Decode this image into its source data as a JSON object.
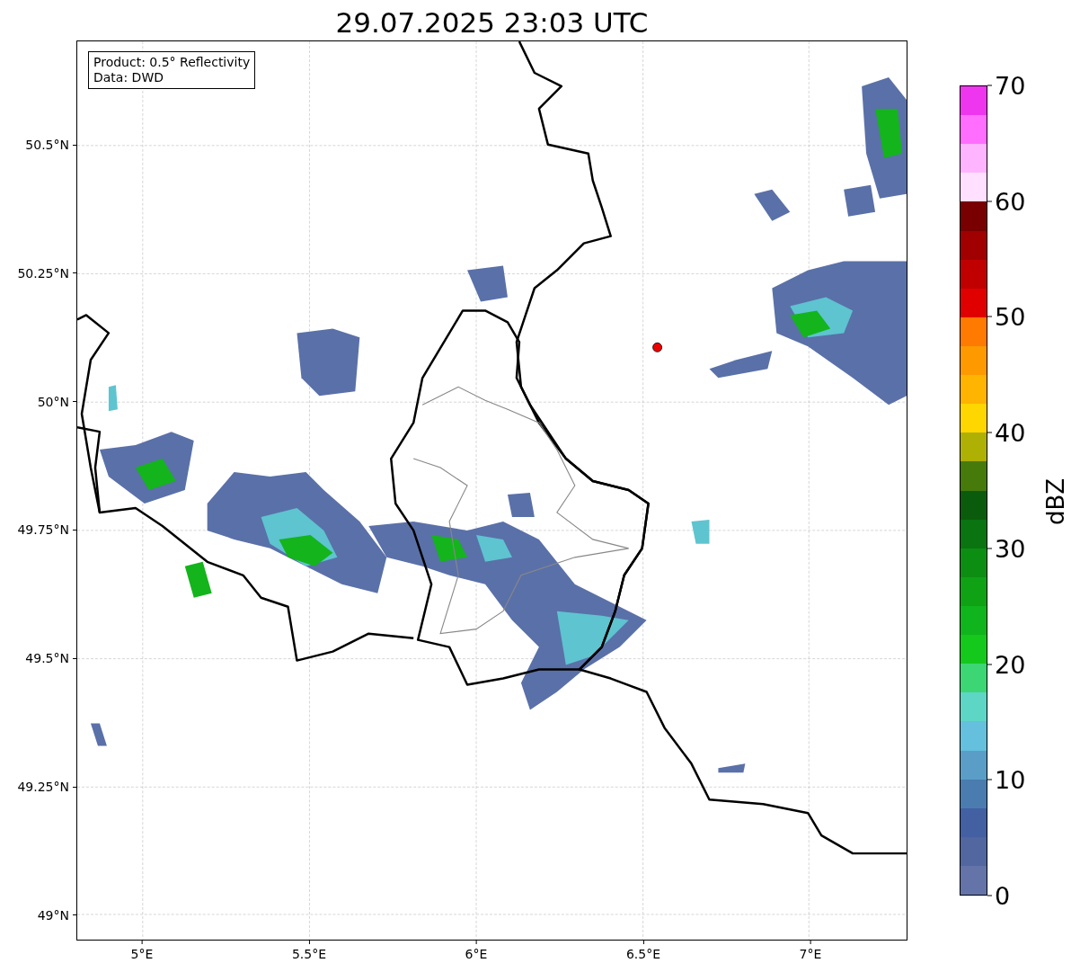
{
  "title": "29.07.2025 23:03 UTC",
  "legend": [
    "Product: 0.5° Reflectivity",
    "Data: DWD"
  ],
  "y_ticks": [
    "50.5°N",
    "50.25°N",
    "50°N",
    "49.75°N",
    "49.5°N",
    "49.25°N",
    "49°N"
  ],
  "x_ticks": [
    "5°E",
    "5.5°E",
    "6°E",
    "6.5°E",
    "7°E"
  ],
  "colorbar": {
    "label": "dBZ",
    "ticks": [
      "70",
      "60",
      "50",
      "40",
      "30",
      "20",
      "10",
      "0"
    ],
    "segments": [
      {
        "color": "#6474a8"
      },
      {
        "color": "#5266a0"
      },
      {
        "color": "#4260a2"
      },
      {
        "color": "#4a7cb0"
      },
      {
        "color": "#5a9ec8"
      },
      {
        "color": "#64c0dc"
      },
      {
        "color": "#5ed6c6"
      },
      {
        "color": "#3cd674"
      },
      {
        "color": "#14c81c"
      },
      {
        "color": "#10b41c"
      },
      {
        "color": "#0ea214"
      },
      {
        "color": "#0c8e12"
      },
      {
        "color": "#0a7410"
      },
      {
        "color": "#0a5c0c"
      },
      {
        "color": "#467a0a"
      },
      {
        "color": "#aeb004"
      },
      {
        "color": "#fed600"
      },
      {
        "color": "#feb400"
      },
      {
        "color": "#fe9a00"
      },
      {
        "color": "#fe7a00"
      },
      {
        "color": "#e00000"
      },
      {
        "color": "#c00000"
      },
      {
        "color": "#a00000"
      },
      {
        "color": "#780000"
      },
      {
        "color": "#ffe0ff"
      },
      {
        "color": "#ffb4ff"
      },
      {
        "color": "#ff6eff"
      },
      {
        "color": "#ee36ee"
      }
    ]
  }
}
